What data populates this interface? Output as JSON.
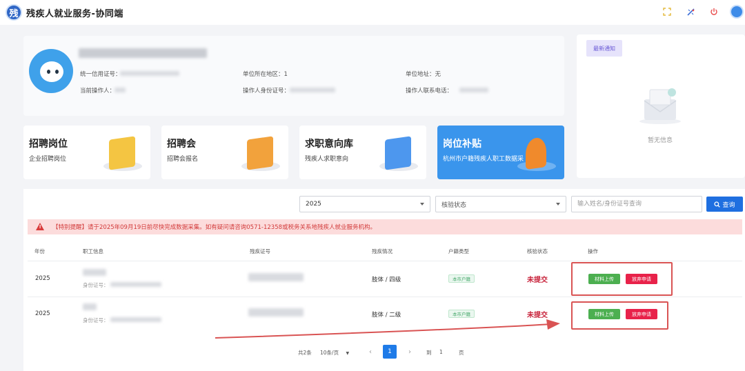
{
  "header": {
    "logo_text": "残",
    "title": "残疾人就业服务-协同端",
    "icons": [
      "fullscreen-icon",
      "theme-icon",
      "power-icon",
      "user-avatar"
    ]
  },
  "profile": {
    "credit_code_label": "统一信用证号：",
    "region_label": "单位所在地区：",
    "region_value": "1",
    "address_label": "单位地址：",
    "address_value": "无",
    "operator_label": "当前操作人：",
    "operator_id_label": "操作人身份证号：",
    "operator_phone_label": "操作人联系电话："
  },
  "notice": {
    "tab": "最新通知",
    "empty": "暂无信息"
  },
  "cards": [
    {
      "title": "招聘岗位",
      "subtitle": "企业招聘岗位"
    },
    {
      "title": "招聘会",
      "subtitle": "招聘会报名"
    },
    {
      "title": "求职意向库",
      "subtitle": "残疾人求职意向"
    },
    {
      "title": "岗位补贴",
      "subtitle": "杭州市户籍残疾人职工数据采"
    }
  ],
  "filters": {
    "year": "2025",
    "status_placeholder": "核验状态",
    "search_placeholder": "输入姓名/身份证号查询",
    "search_button": "查询"
  },
  "alert": "【特别提醒】请于2025年09月19日前尽快完成数据采集。如有疑问请咨询0571-12358或税务关系地残疾人就业服务机构。",
  "table": {
    "headers": [
      "年份",
      "职工信息",
      "残疾证号",
      "残疾情况",
      "户籍类型",
      "核验状态",
      "操作"
    ],
    "id_label": "身份证号：",
    "rows": [
      {
        "year": "2025",
        "disability": "肢体 / 四级",
        "household": "本市户籍",
        "status": "未提交",
        "btn_upload": "材料上传",
        "btn_abandon": "放弃申请"
      },
      {
        "year": "2025",
        "disability": "肢体 / 二级",
        "household": "本市户籍",
        "status": "未提交",
        "btn_upload": "材料上传",
        "btn_abandon": "放弃申请"
      }
    ]
  },
  "pagination": {
    "total": "共2条",
    "page_size": "10条/页",
    "current": "1",
    "goto_label": "到",
    "goto_value": "1",
    "page_suffix": "页"
  },
  "colors": {
    "primary": "#1f6fe0",
    "danger": "#e8224a",
    "success": "#4caf50",
    "annotation": "#d95353"
  }
}
